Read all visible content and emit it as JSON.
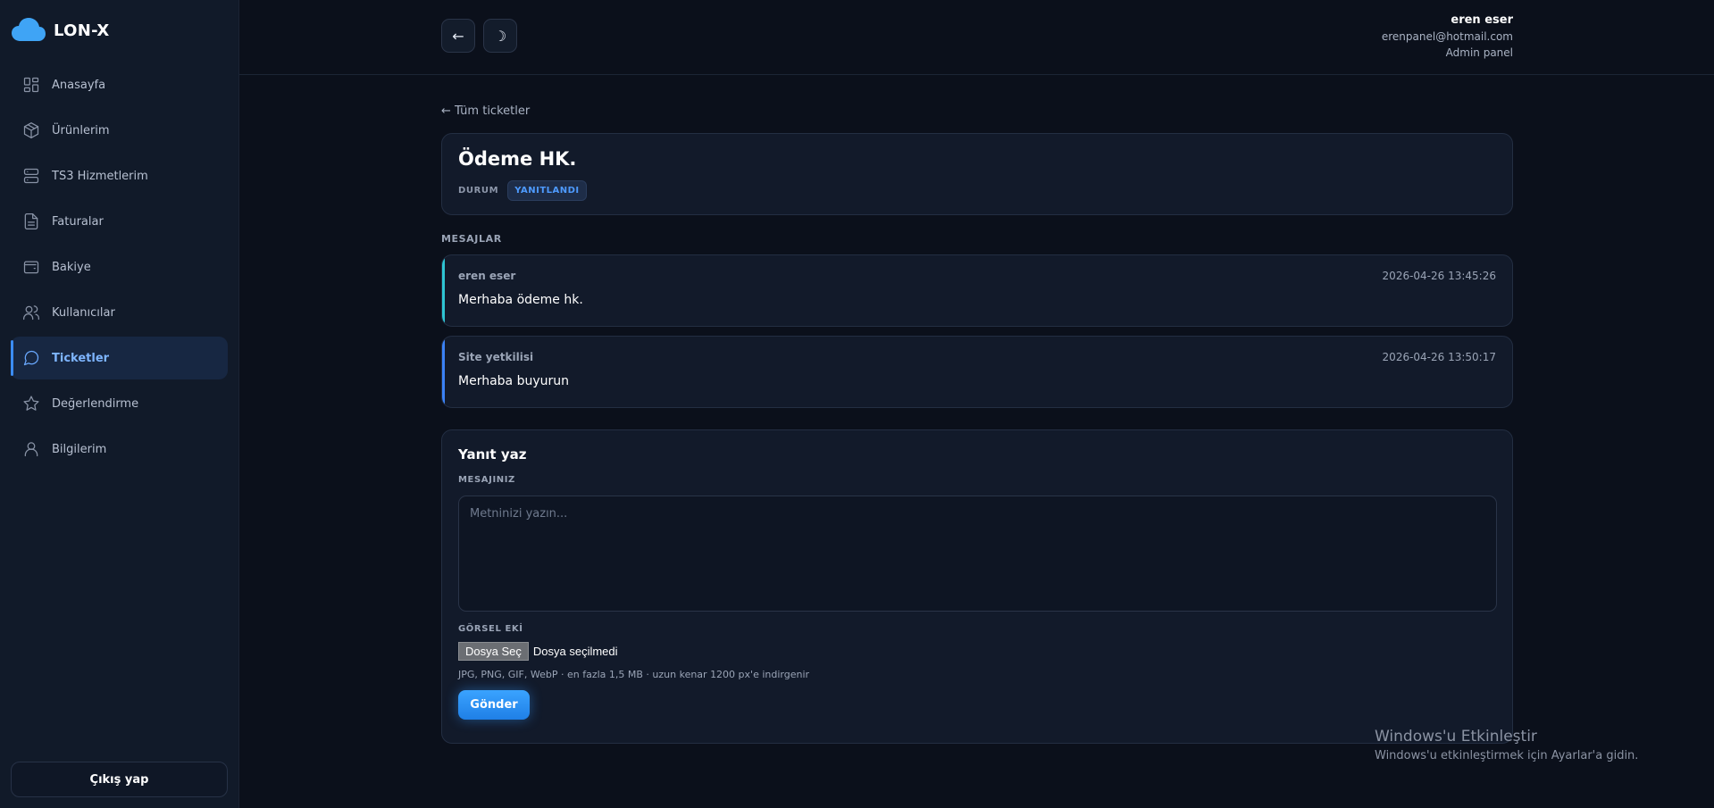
{
  "brand": {
    "name": "LON-X",
    "color": "#3fa4f5"
  },
  "sidebar": {
    "items": [
      {
        "label": "Anasayfa",
        "icon": "dashboard-icon",
        "active": false
      },
      {
        "label": "Ürünlerim",
        "icon": "box-icon",
        "active": false
      },
      {
        "label": "TS3 Hizmetlerim",
        "icon": "server-icon",
        "active": false
      },
      {
        "label": "Faturalar",
        "icon": "document-icon",
        "active": false
      },
      {
        "label": "Bakiye",
        "icon": "wallet-icon",
        "active": false
      },
      {
        "label": "Kullanıcılar",
        "icon": "users-icon",
        "active": false
      },
      {
        "label": "Ticketler",
        "icon": "chat-icon",
        "active": true
      },
      {
        "label": "Değerlendirme",
        "icon": "star-icon",
        "active": false
      },
      {
        "label": "Bilgilerim",
        "icon": "user-icon",
        "active": false
      }
    ],
    "logout_label": "Çıkış yap"
  },
  "topbar": {
    "back_glyph": "←",
    "theme_glyph": "☽",
    "user": {
      "name": "eren eser",
      "email": "erenpanel@hotmail.com",
      "role": "Admin panel"
    }
  },
  "ticket": {
    "back_link": "← Tüm ticketler",
    "title": "Ödeme HK.",
    "status_label": "DURUM",
    "status_value": "YANITLANDI",
    "status_color": "#4e9bff"
  },
  "messages": {
    "heading": "MESAJLAR",
    "items": [
      {
        "author": "eren eser",
        "time": "2026-04-26 13:45:26",
        "body": "Merhaba ödeme hk.",
        "accent": "#2ec5d3"
      },
      {
        "author": "Site yetkilisi",
        "time": "2026-04-26 13:50:17",
        "body": "Merhaba buyurun",
        "accent": "#3b82f6"
      }
    ]
  },
  "reply": {
    "title": "Yanıt yaz",
    "message_label": "MESAJINIZ",
    "placeholder": "Metninizi yazın...",
    "attachment_label": "GÖRSEL EKİ",
    "file_button": "Dosya Seç",
    "file_status": "Dosya seçilmedi",
    "hint": "JPG, PNG, GIF, WebP · en fazla 1,5 MB · uzun kenar 1200 px'e indirgenir",
    "submit_label": "Gönder"
  },
  "watermark": {
    "title": "Windows'u Etkinleştir",
    "subtitle": "Windows'u etkinleştirmek için Ayarlar'a gidin."
  }
}
